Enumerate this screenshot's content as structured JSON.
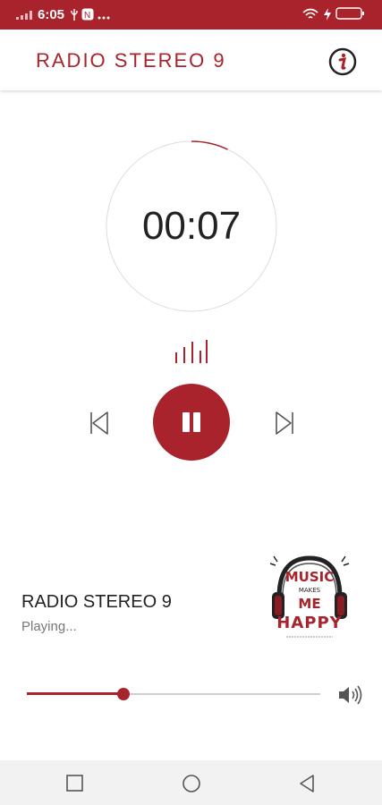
{
  "status_bar": {
    "time": "6:05",
    "battery": "5"
  },
  "header": {
    "title": "RADIO STEREO 9",
    "info_icon": "info-icon"
  },
  "player": {
    "elapsed": "00:07",
    "ring_progress": 0.07,
    "controls": {
      "prev_icon": "skip-previous-icon",
      "pause_icon": "pause-icon",
      "next_icon": "skip-next-icon"
    }
  },
  "now_playing": {
    "station": "RADIO STEREO 9",
    "status": "Playing...",
    "cover_text": "MUSIC MAKES ME HAPPY"
  },
  "volume": {
    "level": 0.33,
    "icon": "volume-icon"
  },
  "nav": {
    "items": [
      "recent-apps-icon",
      "home-icon",
      "back-icon"
    ]
  },
  "colors": {
    "accent": "#a8232b",
    "status_bar": "#a8232b",
    "track": "#cfcfcf"
  }
}
